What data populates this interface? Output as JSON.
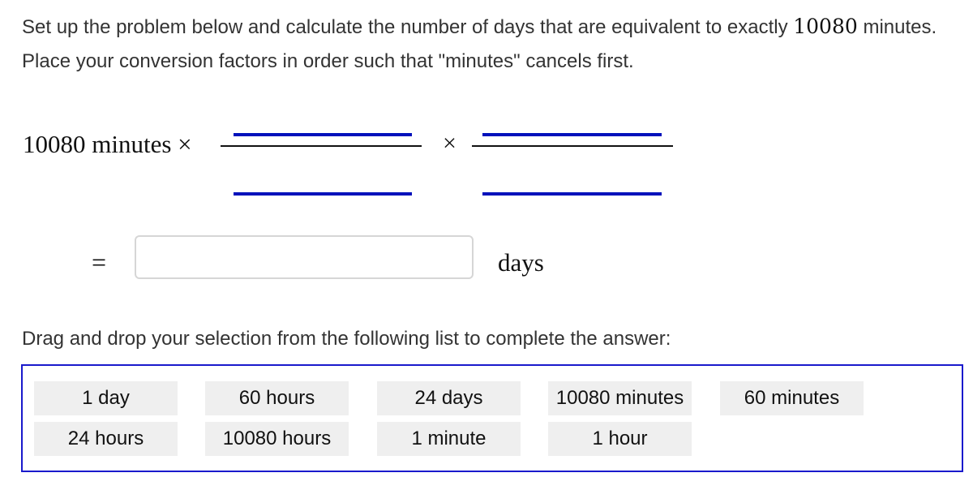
{
  "instructions": {
    "part1": "Set up the problem below and calculate the number of days that are equivalent to exactly ",
    "quantity": "10080",
    "part2": " minutes. Place your conversion factors in order such that \"minutes\" cancels first."
  },
  "expression": {
    "given": "10080 minutes",
    "times_symbol": "×",
    "equals_symbol": "=",
    "answer_value": "",
    "answer_placeholder": "",
    "answer_unit": "days"
  },
  "drag_prompt": "Drag and drop your selection from the following list to complete the answer:",
  "tiles": [
    {
      "label": "1 day"
    },
    {
      "label": "60 hours"
    },
    {
      "label": "24 days"
    },
    {
      "label": "10080 minutes"
    },
    {
      "label": "60 minutes"
    },
    {
      "label": "24 hours"
    },
    {
      "label": "10080 hours"
    },
    {
      "label": "1 minute"
    },
    {
      "label": "1 hour"
    }
  ],
  "colors": {
    "slot": "#0011bb",
    "tile_box_border": "#1a1acc",
    "tile_bg": "#efefef"
  }
}
